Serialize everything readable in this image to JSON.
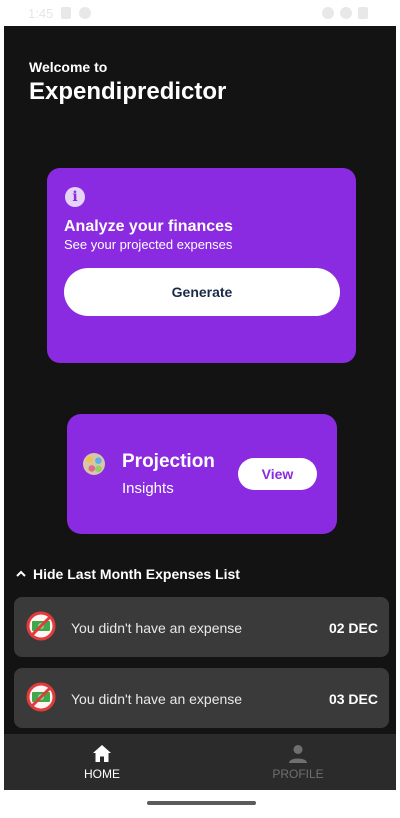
{
  "status_bar": {
    "time": "1:45"
  },
  "header": {
    "welcome": "Welcome to",
    "app_name": "Expendipredictor"
  },
  "analyze_card": {
    "title": "Analyze your finances",
    "subtitle": "See your projected expenses",
    "button_label": "Generate",
    "icon": "info-icon"
  },
  "projection_card": {
    "title": "Projection",
    "subtitle": "Insights",
    "button_label": "View",
    "icon": "insights-avatar-icon"
  },
  "expenses_list": {
    "toggle_label": "Hide Last Month Expenses List",
    "items": [
      {
        "text": "You didn't have an expense",
        "date": "02 DEC",
        "icon": "no-money-icon"
      },
      {
        "text": "You didn't have an expense",
        "date": "03 DEC",
        "icon": "no-money-icon"
      }
    ]
  },
  "bottom_nav": {
    "items": [
      {
        "label": "HOME",
        "icon": "home-icon",
        "active": true
      },
      {
        "label": "PROFILE",
        "icon": "person-icon",
        "active": false
      }
    ]
  },
  "colors": {
    "accent": "#8a2be2",
    "background": "#131313",
    "row_bg": "#3a3a3a",
    "nav_bg": "#2b2b2b"
  }
}
